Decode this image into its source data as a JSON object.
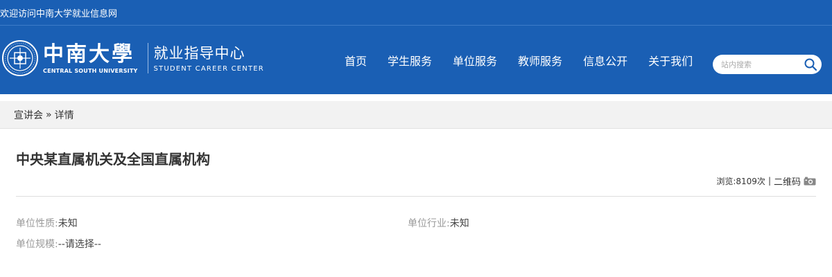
{
  "topbar": {
    "welcome": "欢迎访问中南大学就业信息网"
  },
  "logo": {
    "university_cn": "中南大學",
    "university_en": "CENTRAL SOUTH UNIVERSITY",
    "center_cn": "就业指导中心",
    "center_en": "STUDENT CAREER CENTER"
  },
  "nav": {
    "items": [
      "首页",
      "学生服务",
      "单位服务",
      "教师服务",
      "信息公开",
      "关于我们"
    ]
  },
  "search": {
    "placeholder": "站内搜索"
  },
  "breadcrumb": {
    "section": "宣讲会",
    "separator": "»",
    "current": "详情"
  },
  "article": {
    "title": "中央某直属机关及全国直属机构",
    "views_label": "浏览:",
    "views_value": "8109次",
    "qr_label": "二维码",
    "meta_separator": "|"
  },
  "info": {
    "nature_label": "单位性质:",
    "nature_value": "未知",
    "industry_label": "单位行业:",
    "industry_value": "未知",
    "scale_label": "单位规模:",
    "scale_value": "--请选择--"
  },
  "colors": {
    "brand_blue": "#1a5fb4",
    "breadcrumb_bg": "#f2f2f2"
  }
}
